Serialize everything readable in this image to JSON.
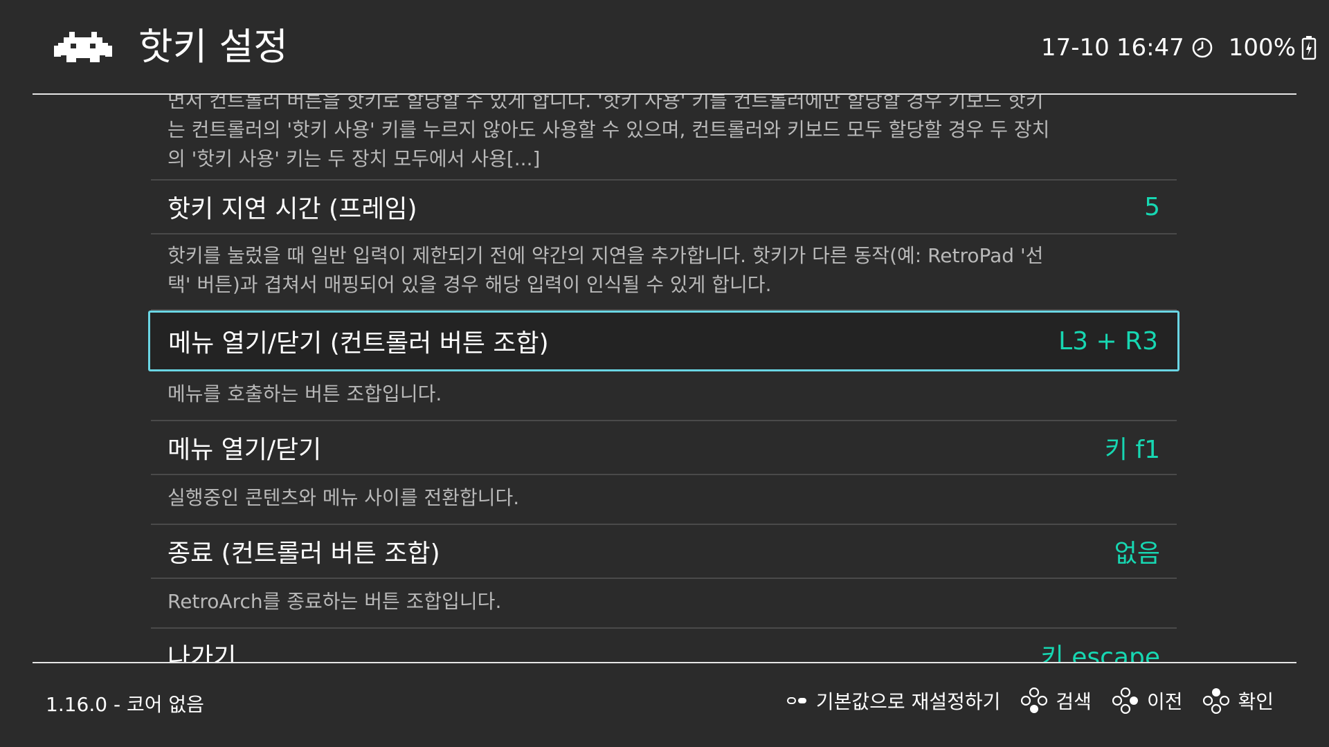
{
  "header": {
    "title": "핫키 설정",
    "date": "17-10",
    "time": "16:47",
    "battery": "100%"
  },
  "settings": {
    "intro_description": {
      "line1": "면서 컨트롤러 버튼을 핫키로 할당할 수 있게 합니다. '핫키 사용' 키를 컨트롤러에만 할당할 경우 키보드 핫키",
      "line2": "는 컨트롤러의 '핫키 사용' 키를 누르지 않아도 사용할 수 있으며, 컨트롤러와 키보드 모두 할당할 경우 두 장치",
      "line3": "의 '핫키 사용' 키는 두 장치 모두에서 사용[...]"
    },
    "items": [
      {
        "label": "핫키 지연 시간 (프레임)",
        "value": "5",
        "description_line1": "핫키를 눌렀을 때 일반 입력이 제한되기 전에 약간의 지연을 추가합니다. 핫키가 다른 동작(예: RetroPad '선",
        "description_line2": "택' 버튼)과 겹쳐서 매핑되어 있을 경우 해당 입력이 인식될 수 있게 합니다."
      },
      {
        "label": "메뉴 열기/닫기 (컨트롤러 버튼 조합)",
        "value": "L3 + R3",
        "description": "메뉴를 호출하는 버튼 조합입니다."
      },
      {
        "label": "메뉴 열기/닫기",
        "value": "키 f1",
        "description": "실행중인 콘텐츠와 메뉴 사이를 전환합니다."
      },
      {
        "label": "종료 (컨트롤러 버튼 조합)",
        "value": "없음",
        "description": "RetroArch를 종료하는 버튼 조합입니다."
      },
      {
        "label": "나가기",
        "value": "키 escape"
      }
    ]
  },
  "footer": {
    "version": "1.16.0 - 코어 없음",
    "hint_reset": "기본값으로 재설정하기",
    "hint_search": "검색",
    "hint_back": "이전",
    "hint_ok": "확인"
  },
  "colors": {
    "background": "#2b2b2b",
    "accent_value": "#17d7b2",
    "selection_border": "#6ad6e4",
    "divider": "#4a4a4a"
  },
  "icons": {
    "logo": "retroarch-invader-logo",
    "clock": "clock-icon",
    "battery": "battery-charging-icon",
    "reset": "select-button-icon",
    "search": "gamepad-buttons-icon",
    "back": "gamepad-buttons-icon",
    "ok": "gamepad-buttons-icon"
  }
}
